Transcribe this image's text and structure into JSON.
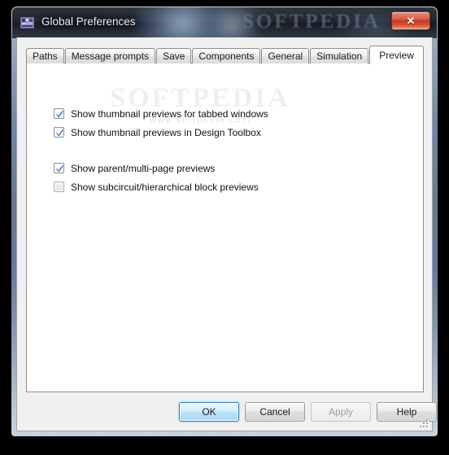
{
  "window": {
    "title": "Global Preferences",
    "icon": "application-icon",
    "close_label": "✕",
    "watermark_title": "SOFTPEDIA"
  },
  "watermark": {
    "big": "SOFTPEDIA",
    "small": "www.softpedia.com"
  },
  "tabs": [
    {
      "label": "Paths",
      "active": false
    },
    {
      "label": "Message prompts",
      "active": false
    },
    {
      "label": "Save",
      "active": false
    },
    {
      "label": "Components",
      "active": false
    },
    {
      "label": "General",
      "active": false
    },
    {
      "label": "Simulation",
      "active": false
    },
    {
      "label": "Preview",
      "active": true
    }
  ],
  "preview_tab": {
    "group_one": [
      {
        "label": "Show thumbnail previews for tabbed windows",
        "checked": true
      },
      {
        "label": "Show thumbnail previews in Design Toolbox",
        "checked": true
      }
    ],
    "group_two": [
      {
        "label": "Show parent/multi-page previews",
        "checked": true
      },
      {
        "label": "Show subcircuit/hierarchical block previews",
        "checked": false
      }
    ]
  },
  "buttons": {
    "ok": "OK",
    "cancel": "Cancel",
    "apply": "Apply",
    "help": "Help"
  },
  "colors": {
    "accent_blue": "#2b7dbd",
    "close_red": "#c53a21",
    "panel_white": "#ffffff",
    "dialog_gray": "#f0f0f0",
    "checkmark_blue": "#2a5fa8"
  }
}
